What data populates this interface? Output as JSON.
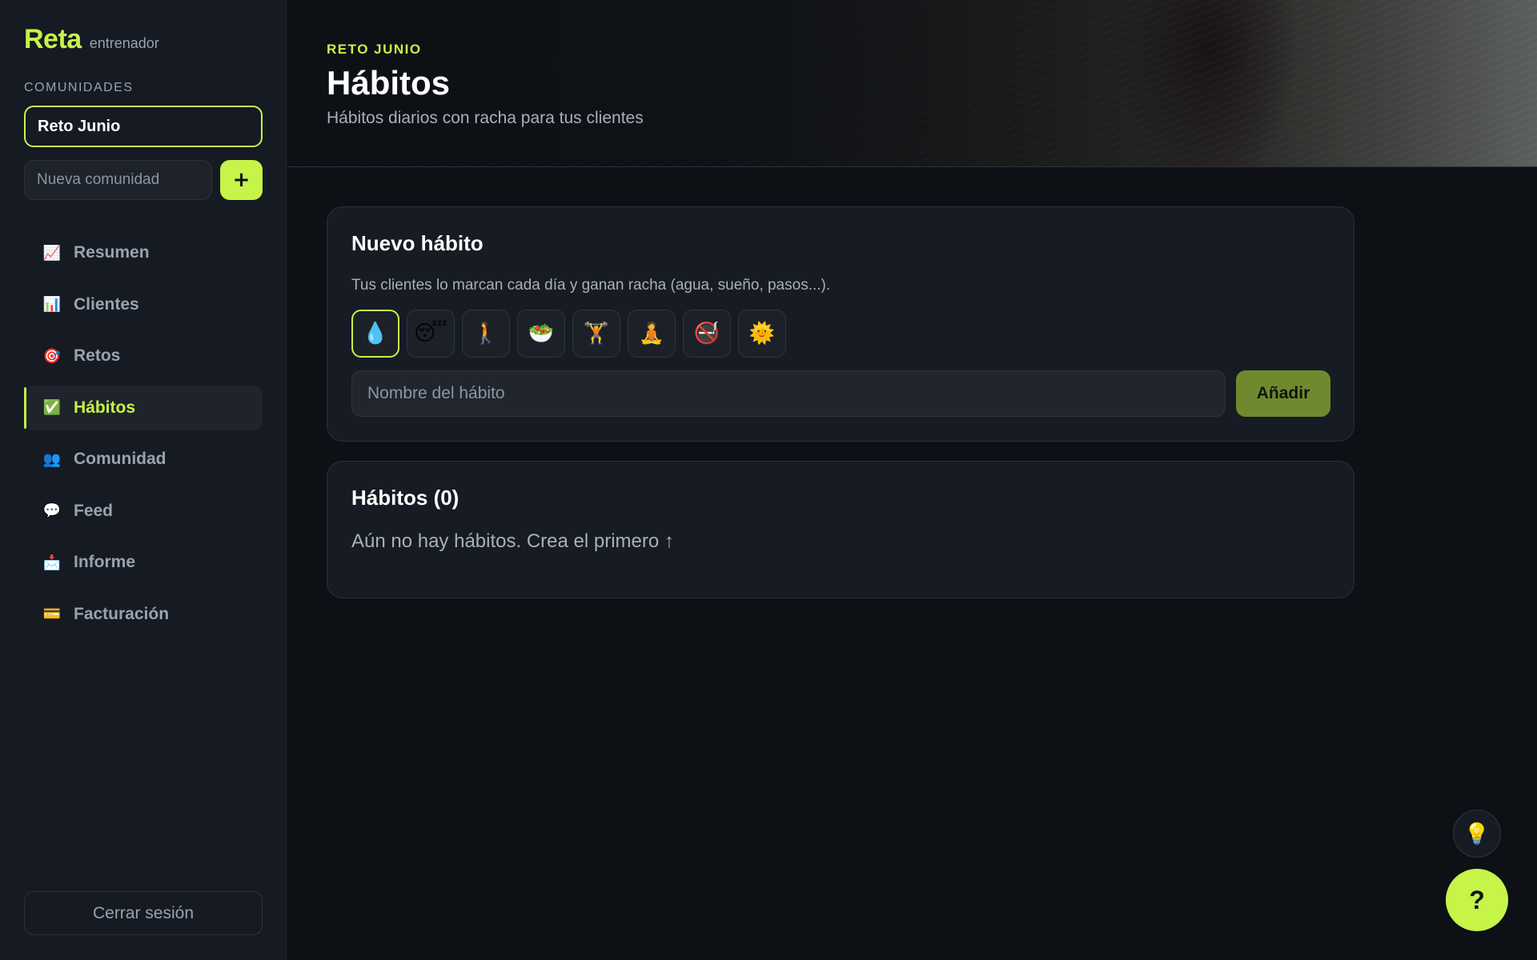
{
  "sidebar": {
    "brand": "Reta",
    "role": "entrenador",
    "section_label": "COMUNIDADES",
    "selected_community": "Reto Junio",
    "new_community_placeholder": "Nueva comunidad",
    "add_label": "+",
    "nav": [
      {
        "label": "Resumen",
        "icon": "chart-increasing-icon",
        "glyph": "📈"
      },
      {
        "label": "Clientes",
        "icon": "bar-chart-icon",
        "glyph": "📊"
      },
      {
        "label": "Retos",
        "icon": "target-icon",
        "glyph": "🎯"
      },
      {
        "label": "Hábitos",
        "icon": "check-box-icon",
        "glyph": "✅",
        "active": true
      },
      {
        "label": "Comunidad",
        "icon": "people-icon",
        "glyph": "👥"
      },
      {
        "label": "Feed",
        "icon": "speech-bubble-icon",
        "glyph": "💬"
      },
      {
        "label": "Informe",
        "icon": "mailbox-icon",
        "glyph": "📩"
      },
      {
        "label": "Facturación",
        "icon": "credit-card-icon",
        "glyph": "💳"
      }
    ],
    "logout_label": "Cerrar sesión"
  },
  "header": {
    "eyebrow": "RETO JUNIO",
    "title": "Hábitos",
    "subtitle": "Hábitos diarios con racha para tus clientes"
  },
  "new_habit": {
    "title": "Nuevo hábito",
    "description": "Tus clientes lo marcan cada día y ganan racha (agua, sueño, pasos...).",
    "icons": [
      {
        "name": "water-drop-icon",
        "glyph": "💧",
        "selected": true
      },
      {
        "name": "sleeping-face-icon",
        "glyph": "😴"
      },
      {
        "name": "person-walking-icon",
        "glyph": "🚶"
      },
      {
        "name": "salad-icon",
        "glyph": "🥗"
      },
      {
        "name": "weightlifter-icon",
        "glyph": "🏋"
      },
      {
        "name": "person-meditating-icon",
        "glyph": "🧘"
      },
      {
        "name": "no-smoking-icon",
        "glyph": "🚭"
      },
      {
        "name": "sun-icon",
        "glyph": "🌞"
      }
    ],
    "input_placeholder": "Nombre del hábito",
    "add_button": "Añadir"
  },
  "habits_list": {
    "title": "Hábitos (0)",
    "empty_text": "Aún no hay hábitos. Crea el primero ↑"
  },
  "floating": {
    "tip_glyph": "💡",
    "help_label": "?"
  },
  "colors": {
    "accent": "#c6f449",
    "background": "#0d1015",
    "sidebar": "#151a23",
    "card": "#171b23"
  }
}
